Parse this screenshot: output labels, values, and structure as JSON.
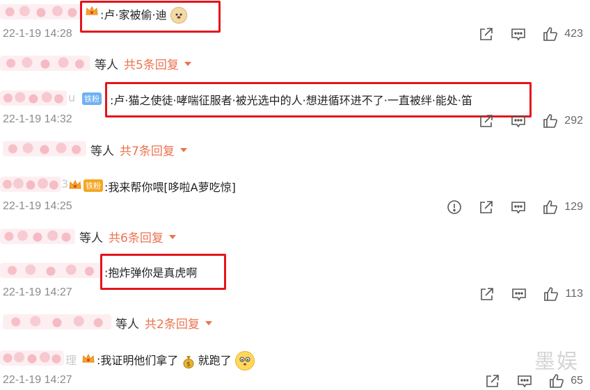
{
  "comments": [
    {
      "text": ":卢·家被偷·迪",
      "time": "22-1-19 14:28",
      "likes": "423",
      "has_report": false,
      "emoji": "dog-face",
      "badge": "crown",
      "replies": {
        "deng": "等人",
        "more": "共5条回复"
      }
    },
    {
      "text": ":卢·猫之使徒·哮喘征服者·被光选中的人·想进循环进不了·一直被绊·能处·笛",
      "time": "22-1-19 14:32",
      "likes": "292",
      "has_report": false,
      "badge": "铁粉",
      "replies": {
        "deng": "等人",
        "more": "共7条回复"
      }
    },
    {
      "text": ":我来帮你喂[哆啦A萝吃惊]",
      "time": "22-1-19 14:25",
      "likes": "129",
      "has_report": true,
      "badge": "铁粉",
      "replies": {
        "deng": "等人",
        "more": "共6条回复"
      }
    },
    {
      "text": ":抱炸弹你是真虎啊",
      "time": "22-1-19 14:27",
      "likes": "113",
      "has_report": false,
      "replies": {
        "deng": "等人",
        "more": "共2条回复"
      }
    },
    {
      "text_a": ":我证明他们拿了",
      "text_b": "就跑了",
      "time": "22-1-19 14:27",
      "likes": "65",
      "has_report": false,
      "badge": "crown"
    }
  ],
  "username_fragments": {
    "c2": "u",
    "c3": "3",
    "c5": "理"
  },
  "watermark": "墨娱",
  "colors": {
    "accent": "#eb7350",
    "highlight_box": "#e5141b",
    "time": "#8a8a8a"
  },
  "icons": [
    "share-icon",
    "comment-icon",
    "like-icon",
    "report-icon",
    "caret-down-icon"
  ]
}
